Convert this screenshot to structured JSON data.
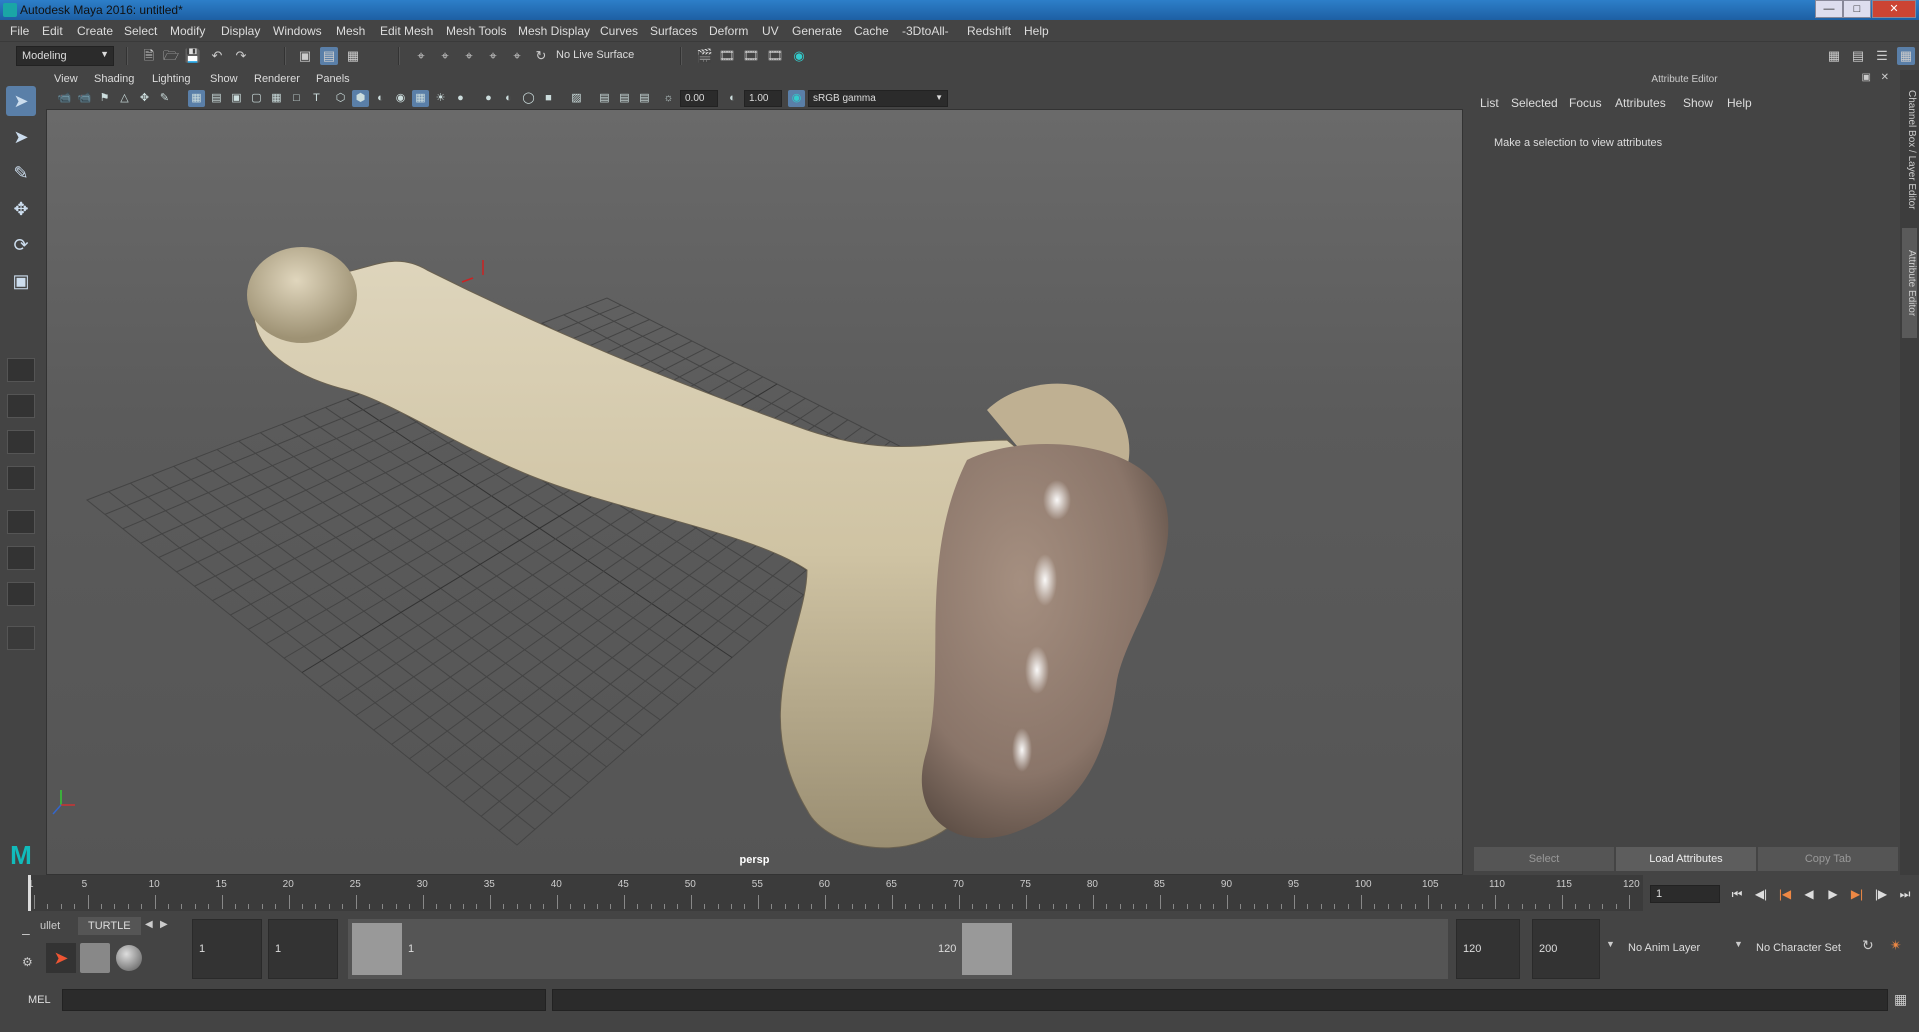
{
  "window": {
    "title": "Autodesk Maya 2016: untitled*"
  },
  "menubar": [
    "File",
    "Edit",
    "Create",
    "Select",
    "Modify",
    "Display",
    "Windows",
    "Mesh",
    "Edit Mesh",
    "Mesh Tools",
    "Mesh Display",
    "Curves",
    "Surfaces",
    "Deform",
    "UV",
    "Generate",
    "Cache",
    "-3DtoAll-",
    "Redshift",
    "Help"
  ],
  "statusline": {
    "mode": "Modeling",
    "live_surface": "No Live Surface"
  },
  "panel": {
    "menus": [
      "View",
      "Shading",
      "Lighting",
      "Show",
      "Renderer",
      "Panels"
    ],
    "exposure": "0.00",
    "gamma": "1.00",
    "colorspace": "sRGB gamma",
    "camera": "persp"
  },
  "attribute_editor": {
    "title": "Attribute Editor",
    "menus": [
      "List",
      "Selected",
      "Focus",
      "Attributes",
      "Show",
      "Help"
    ],
    "message": "Make a selection to view attributes",
    "buttons": {
      "select": "Select",
      "load": "Load Attributes",
      "copy": "Copy Tab"
    }
  },
  "side_tabs": {
    "channel_box": "Channel Box / Layer Editor",
    "attribute_editor": "Attribute Editor"
  },
  "timeline": {
    "ticks": [
      "1",
      "5",
      "10",
      "15",
      "20",
      "25",
      "30",
      "35",
      "40",
      "45",
      "50",
      "55",
      "60",
      "65",
      "70",
      "75",
      "80",
      "85",
      "90",
      "95",
      "100",
      "105",
      "110",
      "115",
      "120"
    ],
    "current_frame": "1"
  },
  "range": {
    "shelf_tabs": [
      "ullet",
      "TURTLE"
    ],
    "start": "1",
    "playback_start": "1",
    "range_start_label": "1",
    "range_end_label": "120",
    "playback_end": "120",
    "end": "200",
    "anim_layer": "No Anim Layer",
    "character_set": "No Character Set"
  },
  "cmdline": {
    "label": "MEL"
  }
}
